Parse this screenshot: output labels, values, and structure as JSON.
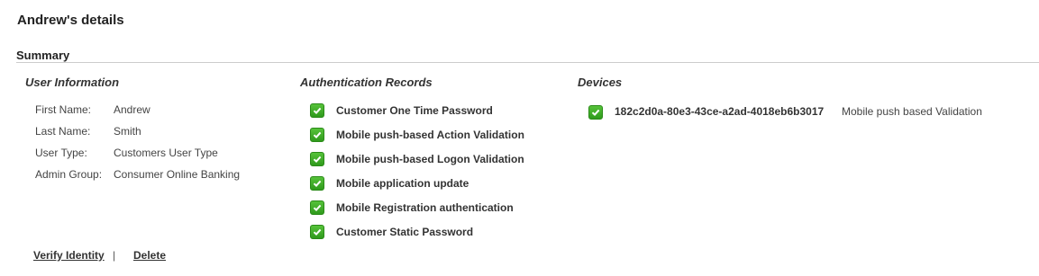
{
  "page": {
    "title": "Andrew's details"
  },
  "summary": {
    "title": "Summary",
    "user_info": {
      "heading": "User Information",
      "fields": [
        {
          "label": "First Name:",
          "value": "Andrew"
        },
        {
          "label": "Last Name:",
          "value": "Smith"
        },
        {
          "label": "User Type:",
          "value": "Customers User Type"
        },
        {
          "label": "Admin Group:",
          "value": "Consumer Online Banking"
        }
      ]
    },
    "auth_records": {
      "heading": "Authentication Records",
      "items": [
        {
          "label": "Customer One Time Password",
          "icon": "check-icon"
        },
        {
          "label": "Mobile push-based Action Validation",
          "icon": "check-icon"
        },
        {
          "label": "Mobile push-based Logon Validation",
          "icon": "check-icon"
        },
        {
          "label": "Mobile application update",
          "icon": "check-icon"
        },
        {
          "label": "Mobile Registration authentication",
          "icon": "check-icon"
        },
        {
          "label": "Customer Static Password",
          "icon": "check-icon"
        }
      ]
    },
    "devices": {
      "heading": "Devices",
      "items": [
        {
          "id": "182c2d0a-80e3-43ce-a2ad-4018eb6b3017",
          "type": "Mobile push based Validation",
          "icon": "check-icon"
        }
      ]
    }
  },
  "actions": {
    "verify_label": "Verify Identity",
    "separator": "|",
    "delete_label": "Delete"
  },
  "colors": {
    "check_green": "#3aa82a",
    "rule": "#cccccc"
  }
}
